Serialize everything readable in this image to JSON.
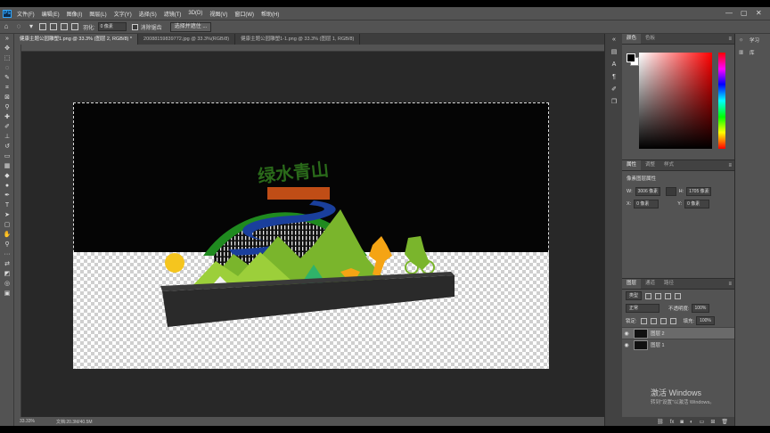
{
  "menu": {
    "app_logo": "Ps",
    "items": [
      "文件(F)",
      "编辑(E)",
      "图像(I)",
      "图层(L)",
      "文字(Y)",
      "选择(S)",
      "滤镜(T)",
      "3D(D)",
      "视图(V)",
      "窗口(W)",
      "帮助(H)"
    ],
    "window_controls": [
      "—",
      "▢",
      "✕"
    ]
  },
  "options": {
    "feather_label": "羽化:",
    "feather_value": "0 像素",
    "antialias_label": "消除锯齿",
    "select_mask_label": "选择并遮住 ..."
  },
  "tabs": [
    {
      "label": "健康主题公园雕塑1.png @ 33.3% (图层 2, RGB/8) *",
      "active": true
    },
    {
      "label": "20088159839772.jpg @ 33.3%(RGB/8)",
      "active": false
    },
    {
      "label": "健康主题公园雕塑1-1.png @ 33.3% (图层 1, RGB/8)",
      "active": false
    }
  ],
  "status": {
    "zoom": "33.33%",
    "doc": "文档:20.3M/40.5M"
  },
  "color_panel": {
    "tabs": [
      "颜色",
      "色板"
    ]
  },
  "properties_panel": {
    "tabs": [
      "属性",
      "调整",
      "样式"
    ],
    "title": "像素图层属性",
    "w_label": "W:",
    "w_value": "3006 像素",
    "h_label": "H:",
    "h_value": "1705 像素",
    "x_label": "X:",
    "x_value": "0 像素",
    "y_label": "Y:",
    "y_value": "0 像素"
  },
  "layers_panel": {
    "tabs": [
      "图层",
      "通道",
      "路径"
    ],
    "filter_kind": "类型",
    "blend_mode": "正常",
    "opacity_label": "不透明度:",
    "opacity_value": "100%",
    "lock_label": "锁定:",
    "fill_label": "填充:",
    "fill_value": "100%",
    "layers": [
      {
        "name": "图层 2",
        "active": true
      },
      {
        "name": "图层 1",
        "active": false
      }
    ]
  },
  "far_right": {
    "items": [
      {
        "icon": "lightbulb-icon",
        "label": "学习"
      },
      {
        "icon": "library-icon",
        "label": "库"
      }
    ]
  },
  "watermark": {
    "line1": "激活 Windows",
    "line2": "转到\"设置\"以激活 Windows。"
  },
  "colors": {
    "arch_green": "#1f8a1f",
    "mountain_green": "#7ab52c",
    "river_blue": "#1a3f9c",
    "orange": "#f5a414",
    "base_gray": "#2a2a2a"
  }
}
